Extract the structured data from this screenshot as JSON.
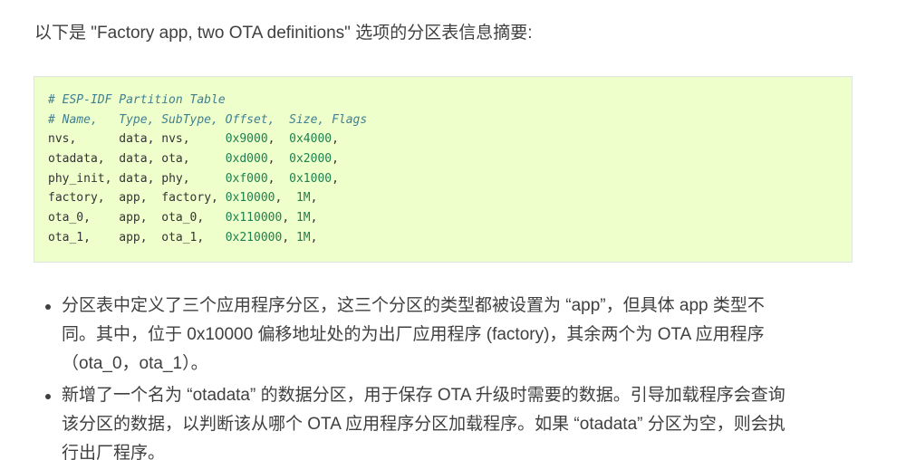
{
  "intro": "以下是 \"Factory app, two OTA definitions\" 选项的分区表信息摘要:",
  "code": {
    "comment_title": "# ESP-IDF Partition Table",
    "comment_header": "# Name,   Type, SubType, Offset,  Size, Flags",
    "rows": [
      {
        "name": "nvs,      ",
        "type": "data, ",
        "subtype": "nvs,     ",
        "offset": "0x9000",
        "size": "0x4000"
      },
      {
        "name": "otadata,  ",
        "type": "data, ",
        "subtype": "ota,     ",
        "offset": "0xd000",
        "size": "0x2000"
      },
      {
        "name": "phy_init, ",
        "type": "data, ",
        "subtype": "phy,     ",
        "offset": "0xf000",
        "size": "0x1000"
      },
      {
        "name": "factory,  ",
        "type": "app,  ",
        "subtype": "factory, ",
        "offset": "0x10000",
        "size": "1M"
      },
      {
        "name": "ota_0,    ",
        "type": "app,  ",
        "subtype": "ota_0,   ",
        "offset": "0x110000",
        "size": "1M"
      },
      {
        "name": "ota_1,    ",
        "type": "app,  ",
        "subtype": "ota_1,   ",
        "offset": "0x210000",
        "size": "1M"
      }
    ]
  },
  "bullets": [
    {
      "lines": [
        "分区表中定义了三个应用程序分区，这三个分区的类型都被设置为 “app”，但具体 app 类型不",
        "同。其中，位于 0x10000 偏移地址处的为出厂应用程序 (factory)，其余两个为 OTA 应用程序",
        "（ota_0，ota_1）。"
      ]
    },
    {
      "lines": [
        "新增了一个名为 “otadata” 的数据分区，用于保存 OTA 升级时需要的数据。引导加载程序会查询",
        "该分区的数据，以判断该从哪个 OTA 应用程序分区加载程序。如果 “otadata” 分区为空，则会执",
        "行出厂程序。"
      ]
    }
  ]
}
